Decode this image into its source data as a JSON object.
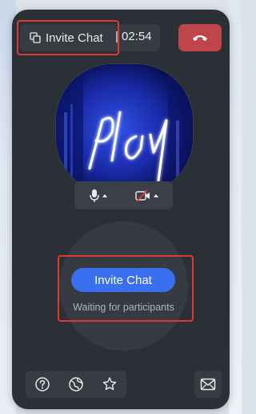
{
  "header": {
    "invite_label": "Invite Chat",
    "separator": "|",
    "timer": "02:54",
    "copy_icon": "copy-icon",
    "hangup_icon": "phone-hangup-icon",
    "hangup_color": "#c0454a"
  },
  "video": {
    "neon_text": "play",
    "background_color": "#061054"
  },
  "media_controls": {
    "mic_icon": "microphone-icon",
    "camera_icon": "camera-off-icon"
  },
  "center": {
    "invite_button_label": "Invite Chat",
    "status_text": "Waiting for participants",
    "accent": "#3a6ff0"
  },
  "toolbar": {
    "help_icon": "help-icon",
    "globe_icon": "globe-icon",
    "pin_icon": "pin-icon",
    "mail_icon": "mail-icon"
  },
  "highlight_color": "#e0392d"
}
